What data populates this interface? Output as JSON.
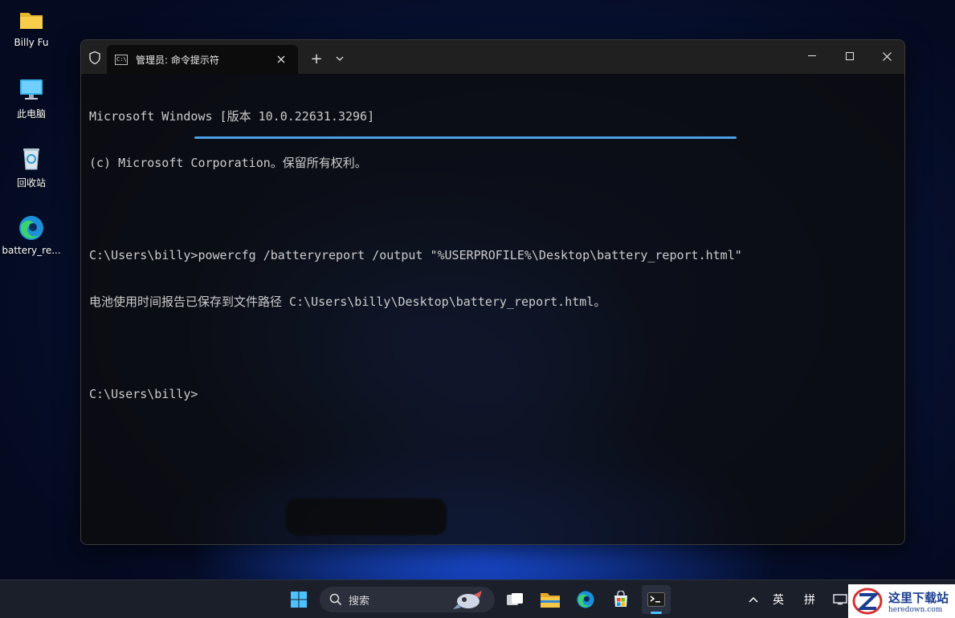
{
  "desktop": {
    "icons": [
      {
        "label": "Billy Fu",
        "icon": "folder-icon"
      },
      {
        "label": "此电脑",
        "icon": "computer-icon"
      },
      {
        "label": "回收站",
        "icon": "recycle-bin-icon"
      },
      {
        "label": "battery_re...",
        "icon": "edge-icon"
      }
    ]
  },
  "terminal": {
    "tab_title": "管理员: 命令提示符",
    "new_tab_label": "+",
    "lines": [
      "Microsoft Windows [版本 10.0.22631.3296]",
      "(c) Microsoft Corporation。保留所有权利。",
      "",
      "C:\\Users\\billy>powercfg /batteryreport /output \"%USERPROFILE%\\Desktop\\battery_report.html\"",
      "电池使用时间报告已保存到文件路径 C:\\Users\\billy\\Desktop\\battery_report.html。",
      "",
      "C:\\Users\\billy>"
    ],
    "accent_color": "#4aa0e6"
  },
  "taskbar": {
    "search_placeholder": "搜索",
    "tray_lang": "英",
    "tray_ime": "拼",
    "icons": [
      "start-icon",
      "search-icon",
      "task-view-icon",
      "file-explorer-icon",
      "edge-icon",
      "store-icon",
      "terminal-icon"
    ]
  },
  "watermark": {
    "brand": "这里下载站",
    "url": "heredown.com"
  }
}
